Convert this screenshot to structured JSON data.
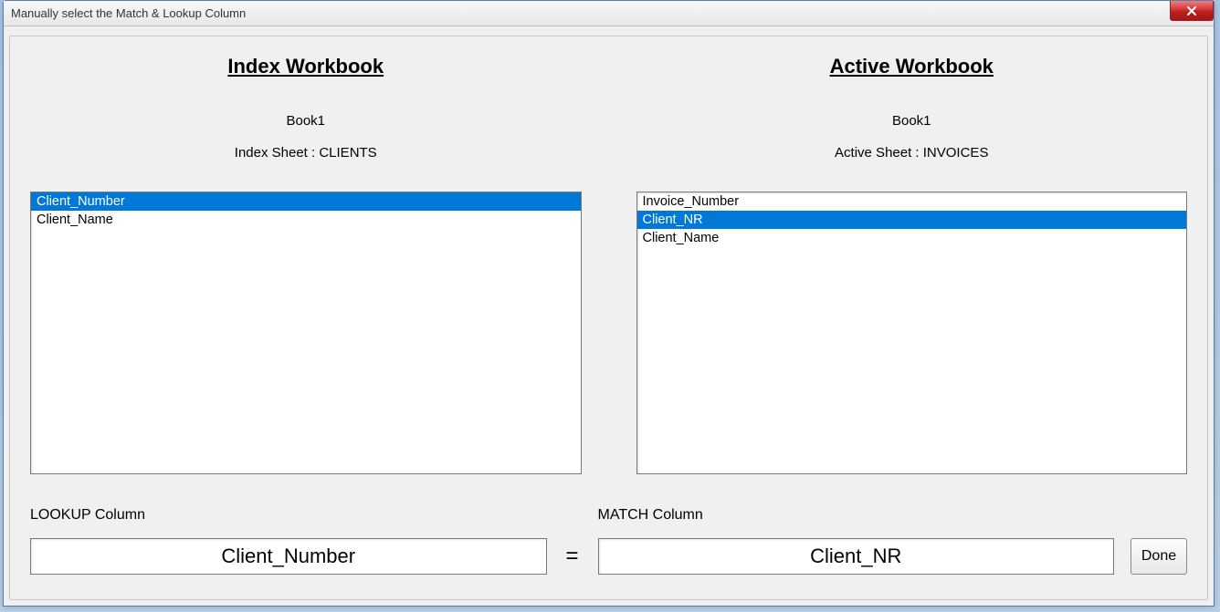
{
  "window": {
    "title": "Manually select the Match & Lookup Column"
  },
  "index": {
    "heading": "Index Workbook",
    "workbook": "Book1",
    "sheet_label": "Index Sheet : CLIENTS",
    "items": [
      {
        "label": "Client_Number",
        "selected": true
      },
      {
        "label": "Client_Name",
        "selected": false
      }
    ]
  },
  "active": {
    "heading": "Active Workbook",
    "workbook": "Book1",
    "sheet_label": "Active Sheet : INVOICES",
    "items": [
      {
        "label": "Invoice_Number",
        "selected": false
      },
      {
        "label": "Client_NR",
        "selected": true
      },
      {
        "label": "Client_Name",
        "selected": false
      }
    ]
  },
  "lookup": {
    "label": "LOOKUP Column",
    "value": "Client_Number"
  },
  "match": {
    "label": "MATCH Column",
    "value": "Client_NR"
  },
  "equals_symbol": "=",
  "done_label": "Done"
}
